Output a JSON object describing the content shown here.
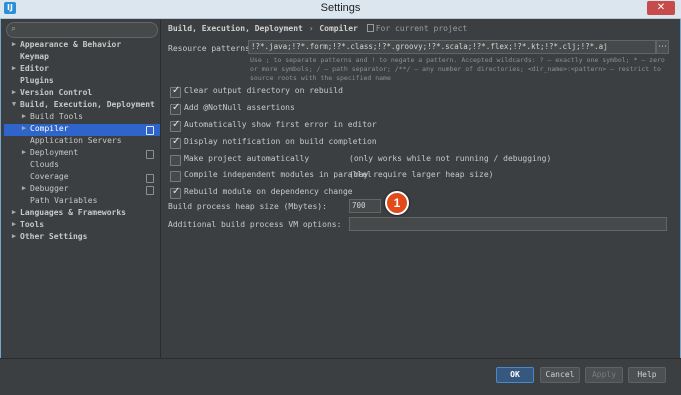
{
  "window": {
    "app_icon": "IJ",
    "title": "Settings",
    "close_glyph": "✕"
  },
  "sidebar": {
    "search_placeholder": "",
    "items": [
      {
        "label": "Appearance & Behavior",
        "arrow": "right",
        "bold": true
      },
      {
        "label": "Keymap",
        "arrow": "",
        "bold": true
      },
      {
        "label": "Editor",
        "arrow": "right",
        "bold": true
      },
      {
        "label": "Plugins",
        "arrow": "",
        "bold": true
      },
      {
        "label": "Version Control",
        "arrow": "right",
        "bold": true
      },
      {
        "label": "Build, Execution, Deployment",
        "arrow": "down",
        "bold": true
      },
      {
        "label": "Build Tools",
        "arrow": "right"
      },
      {
        "label": "Compiler",
        "arrow": "right",
        "selected": true
      },
      {
        "label": "Application Servers",
        "arrow": ""
      },
      {
        "label": "Deployment",
        "arrow": "right"
      },
      {
        "label": "Clouds",
        "arrow": ""
      },
      {
        "label": "Coverage",
        "arrow": ""
      },
      {
        "label": "Debugger",
        "arrow": "right"
      },
      {
        "label": "Path Variables",
        "arrow": ""
      },
      {
        "label": "Languages & Frameworks",
        "arrow": "right",
        "bold": true
      },
      {
        "label": "Tools",
        "arrow": "right",
        "bold": true
      },
      {
        "label": "Other Settings",
        "arrow": "right",
        "bold": true
      }
    ]
  },
  "content": {
    "breadcrumb": {
      "part1": "Build, Execution, Deployment",
      "sep": "›",
      "part2": "Compiler",
      "note": "For current project"
    },
    "resource_label": "Resource patterns:",
    "resource_value": "!?*.java;!?*.form;!?*.class;!?*.groovy;!?*.scala;!?*.flex;!?*.kt;!?*.clj;!?*.aj",
    "resource_expand": "⋯",
    "hint": "Use ; to separate patterns and ! to negate a pattern. Accepted wildcards: ? — exactly one symbol; * — zero or more symbols; / — path separator; /**/ — any number of directories; <dir_name>:<pattern> — restrict to source roots with the specified name",
    "checkboxes": [
      {
        "label": "Clear output directory on rebuild",
        "checked": true,
        "note": ""
      },
      {
        "label": "Add @NotNull assertions",
        "checked": true,
        "note": ""
      },
      {
        "label": "Automatically show first error in editor",
        "checked": true,
        "note": ""
      },
      {
        "label": "Display notification on build completion",
        "checked": true,
        "note": ""
      },
      {
        "label": "Make project automatically",
        "checked": false,
        "note": "(only works while not running / debugging)"
      },
      {
        "label": "Compile independent modules in parallel",
        "checked": false,
        "note": "(may require larger heap size)"
      },
      {
        "label": "Rebuild module on dependency change",
        "checked": true,
        "note": ""
      }
    ],
    "heap_label": "Build process heap size (Mbytes):",
    "heap_value": "700",
    "vm_label": "Additional build process VM options:",
    "vm_value": "",
    "callout": "1"
  },
  "footer": {
    "ok": "OK",
    "cancel": "Cancel",
    "apply": "Apply",
    "help": "Help"
  },
  "colors": {
    "background": "#3c3f41",
    "selection": "#2f65ca",
    "callout": "#e24a1a"
  }
}
